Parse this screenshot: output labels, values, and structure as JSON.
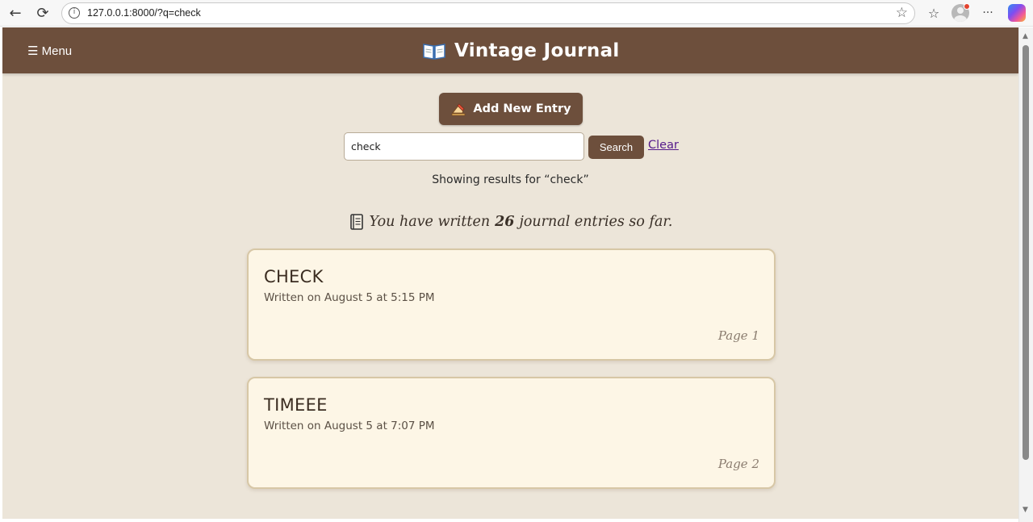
{
  "browser": {
    "url": "127.0.0.1:8000/?q=check",
    "back_icon": "arrow-left-icon",
    "reload_icon": "reload-icon"
  },
  "header": {
    "menu_label": "☰ Menu",
    "title": "Vintage Journal",
    "background": "#6d4f3c"
  },
  "actions": {
    "add_entry_label": "Add New Entry"
  },
  "search": {
    "value": "check",
    "button_label": "Search",
    "clear_label": "Clear"
  },
  "results": {
    "text": "Showing results for “check”"
  },
  "stats": {
    "prefix": "You have written",
    "count": "26",
    "suffix": "journal entries so far."
  },
  "entries": [
    {
      "title": "CHECK",
      "meta": "Written on August 5 at 5:15 PM",
      "page": "Page 1"
    },
    {
      "title": "TIMEEE",
      "meta": "Written on August 5 at 7:07 PM",
      "page": "Page 2"
    }
  ]
}
